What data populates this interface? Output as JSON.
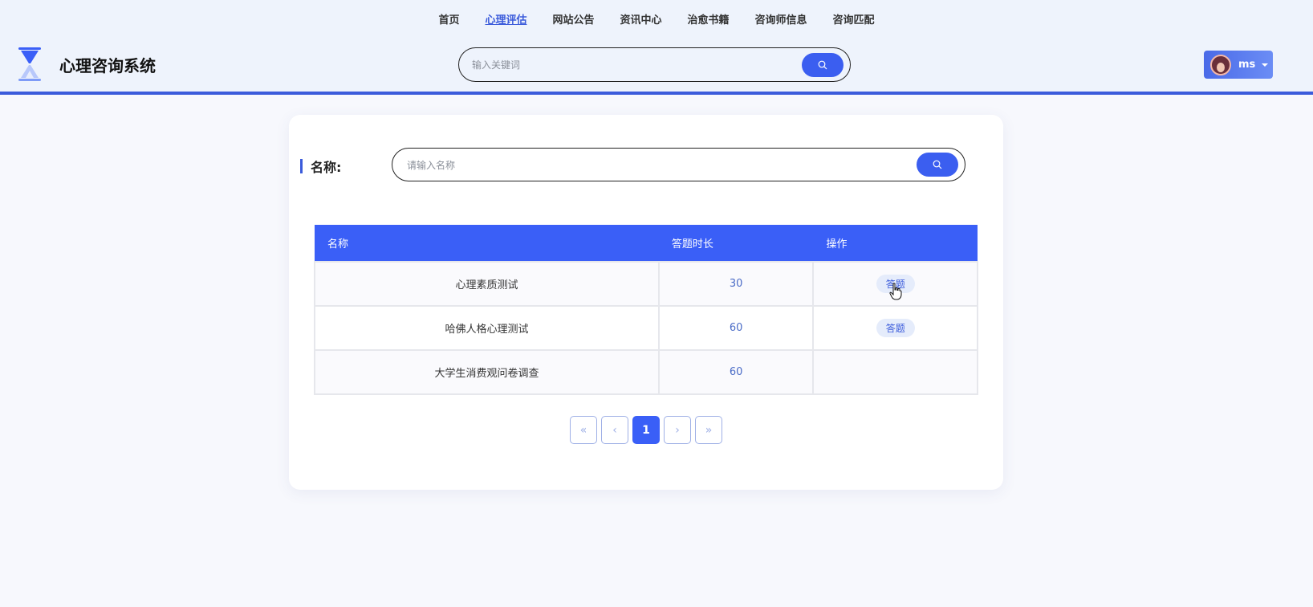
{
  "topnav": [
    {
      "label": "首页",
      "active": false
    },
    {
      "label": "心理评估",
      "active": true
    },
    {
      "label": "网站公告",
      "active": false
    },
    {
      "label": "资讯中心",
      "active": false
    },
    {
      "label": "治愈书籍",
      "active": false
    },
    {
      "label": "咨询师信息",
      "active": false
    },
    {
      "label": "咨询匹配",
      "active": false
    }
  ],
  "brand": {
    "title": "心理咨询系统",
    "logo_icon": "hourglass-icon"
  },
  "top_search": {
    "placeholder": "输入关键词",
    "icon": "search-icon"
  },
  "user": {
    "name": "ms",
    "avatar_icon": "avatar"
  },
  "filter": {
    "label": "名称:",
    "placeholder": "请输入名称"
  },
  "table": {
    "headers": [
      "名称",
      "答题时长",
      "操作"
    ],
    "rows": [
      {
        "name": "心理素质测试",
        "duration": "30",
        "action": "答题"
      },
      {
        "name": "哈佛人格心理测试",
        "duration": "60",
        "action": "答题"
      },
      {
        "name": "大学生消费观问卷调查",
        "duration": "60",
        "action": ""
      }
    ]
  },
  "pagination": {
    "first": "«",
    "prev": "‹",
    "current": "1",
    "next": "›",
    "last": "»"
  },
  "colors": {
    "primary": "#3a5ff7",
    "header_bg": "#eef3fc",
    "accent_border": "#3b5bdb"
  }
}
